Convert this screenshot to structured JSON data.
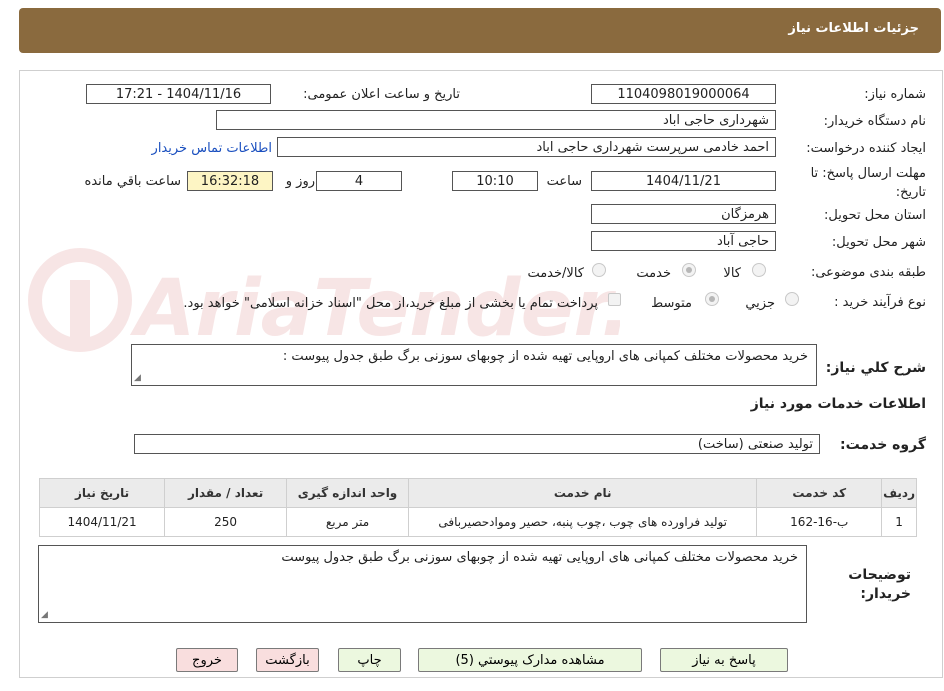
{
  "header": {
    "title": "جزئیات اطلاعات نیاز"
  },
  "form": {
    "need_number_label": "شماره نیاز:",
    "need_number": "1104098019000064",
    "announce_label": "تاریخ و ساعت اعلان عمومی:",
    "announce_value": "1404/11/16 - 17:21",
    "buyer_org_label": "نام دستگاه خریدار:",
    "buyer_org": "شهرداری حاجی اباد",
    "requester_label": "ایجاد کننده درخواست:",
    "requester": "احمد خادمی سرپرست شهرداری حاجی اباد",
    "buyer_contact_link": "اطلاعات تماس خریدار",
    "deadline_label_line1": "مهلت ارسال پاسخ: تا",
    "deadline_label_line2": "تاریخ:",
    "deadline_date": "1404/11/21",
    "time_label": "ساعت",
    "deadline_time": "10:10",
    "days_value": "4",
    "days_label": "روز و",
    "remaining_time": "16:32:18",
    "remaining_label": "ساعت باقي مانده",
    "province_label": "استان محل تحویل:",
    "province": "هرمزگان",
    "city_label": "شهر محل تحویل:",
    "city": "حاجی آباد",
    "category_label": "طبقه بندی موضوعی:",
    "category_options": [
      "کالا",
      "خدمت",
      "کالا/خدمت"
    ],
    "category_selected": "خدمت",
    "process_label": "نوع فرآیند خرید :",
    "process_options": [
      "جزیي",
      "متوسط"
    ],
    "process_selected": "متوسط",
    "treasury_note": "پرداخت تمام یا بخشی از مبلغ خرید،از محل \"اسناد خزانه اسلامی\" خواهد بود.",
    "description_label": "شرح کلي نیاز:",
    "description": "خرید محصولات  مختلف کمپانی های اروپایی تهیه شده از چوبهای سوزنی برگ طبق جدول پیوست   :"
  },
  "services": {
    "section_title": "اطلاعات خدمات مورد نیاز",
    "group_label": "گروه خدمت:",
    "group_value": "تولید صنعتی (ساخت)",
    "columns": [
      "ردیف",
      "کد خدمت",
      "نام خدمت",
      "واحد اندازه گیری",
      "تعداد / مقدار",
      "تاریخ نیاز"
    ],
    "rows": [
      [
        "1",
        "ب-16-162",
        "تولید فراورده های چوب ،چوب پنبه، حصیر وموادحصیربافی",
        "متر مربع",
        "250",
        "1404/11/21"
      ]
    ]
  },
  "buyer_notes": {
    "label_line1": "توضیحات",
    "label_line2": "خریدار:",
    "text": "خرید محصولات  مختلف کمپانی های اروپایی تهیه شده از چوبهای سوزنی برگ طبق جدول پیوست"
  },
  "buttons": {
    "reply": "پاسخ به نیاز",
    "attachments": "مشاهده مدارک پیوستي (5)",
    "print": "چاپ",
    "back": "بازگشت",
    "exit": "خروج"
  },
  "watermark": {
    "text": "AriaTender.neT"
  },
  "colors": {
    "header_bg": "#8a6a3e",
    "button_green": "#ecf8df",
    "button_pink": "#f9dede",
    "highlight_yellow": "#fdf5c4",
    "link": "#1a4fbf"
  }
}
